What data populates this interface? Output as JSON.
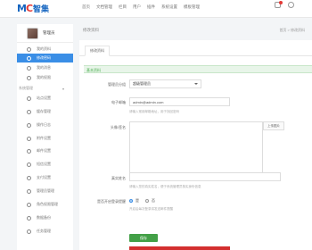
{
  "logo": {
    "mark_a": "M",
    "mark_b": "C",
    "name": "智集"
  },
  "topnav": [
    "首页",
    "文档管理",
    "栏目",
    "用户",
    "插件",
    "系统设置",
    "模板管理"
  ],
  "profile": {
    "name": "管理员"
  },
  "sidebar": {
    "items_top": [
      "我的资料",
      "修改密码",
      "我的消息",
      "我的权限"
    ],
    "section_label": "系统管理",
    "items": [
      "站点设置",
      "缓存管理",
      "操作日志",
      "附件设置",
      "邮件设置",
      "短信设置",
      "支付设置",
      "管理员管理",
      "角色权限管理",
      "数据备份",
      "任务管理"
    ]
  },
  "crumb": {
    "title": "修改资料",
    "path": "首页 > 修改资料"
  },
  "tabs": [
    "修改资料"
  ],
  "section": "基本资料",
  "form": {
    "group_label": "管理员分组",
    "group_value": "超级管理员",
    "email_label": "电子邮箱",
    "email_value": "admin@admin.com",
    "email_hint": "请输入常用邮箱地址，用于找回密码",
    "avatar_label": "头像/签名",
    "avatar_button": "上传图片",
    "name_label": "真实姓名",
    "name_hint": "请输入您的真实姓名，便于系统管理员核实身份信息",
    "radio_label": "是否开启登录提醒",
    "radio_on": "是",
    "radio_off": "否",
    "radio_hint": "开启后每次登录将发送邮件提醒",
    "submit": "保存"
  },
  "colors": {
    "accent": "#3a8ee6",
    "success": "#43a047",
    "danger": "#d32f2f"
  }
}
